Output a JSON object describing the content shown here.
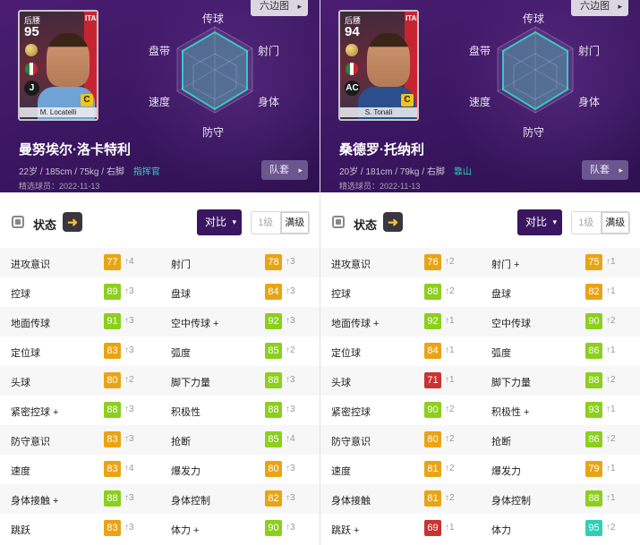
{
  "players": [
    {
      "card": {
        "position": "后腰",
        "rating": "95",
        "flag_text": "ITALIA",
        "club_badge": "J",
        "style_badge": "C",
        "card_name": "M. Locatelli",
        "shirt": "light",
        "flag_colors": [
          "#1f8a3a",
          "#ffffff",
          "#c62a30"
        ]
      },
      "hex_button": "六边图",
      "radar_labels": {
        "top": "传球",
        "upper_left": "盘带",
        "upper_right": "射门",
        "lower_left": "速度",
        "lower_right": "身体",
        "bottom": "防守"
      },
      "name": "曼努埃尔·洛卡特利",
      "info": "22岁 / 185cm / 75kg / 右脚",
      "play_style": "指挥官",
      "featured_date": "精选球员：2022-11-13",
      "team_button": "队套",
      "status": {
        "title": "状态",
        "arrow_icon": "➜",
        "compare_button": "对比",
        "level_1": "1级",
        "level_max": "满级"
      },
      "stats": [
        [
          {
            "label": "进攻意识",
            "value": "77",
            "inc": "↑4",
            "tier": "g80"
          },
          {
            "label": "射门",
            "value": "78",
            "inc": "↑3",
            "tier": "g80"
          }
        ],
        [
          {
            "label": "控球",
            "value": "89",
            "inc": "↑3",
            "tier": "g90"
          },
          {
            "label": "盘球",
            "value": "84",
            "inc": "↑3",
            "tier": "g80"
          }
        ],
        [
          {
            "label": "地面传球",
            "value": "91",
            "inc": "↑3",
            "tier": "g90"
          },
          {
            "label": "空中传球 +",
            "value": "92",
            "inc": "↑3",
            "tier": "g90"
          }
        ],
        [
          {
            "label": "定位球",
            "value": "83",
            "inc": "↑3",
            "tier": "g80"
          },
          {
            "label": "弧度",
            "value": "85",
            "inc": "↑2",
            "tier": "g90"
          }
        ],
        [
          {
            "label": "头球",
            "value": "80",
            "inc": "↑2",
            "tier": "g80"
          },
          {
            "label": "脚下力量",
            "value": "88",
            "inc": "↑3",
            "tier": "g90"
          }
        ],
        [
          {
            "label": "紧密控球 +",
            "value": "88",
            "inc": "↑3",
            "tier": "g90"
          },
          {
            "label": "积极性",
            "value": "88",
            "inc": "↑3",
            "tier": "g90"
          }
        ],
        [
          {
            "label": "防守意识",
            "value": "83",
            "inc": "↑3",
            "tier": "g80"
          },
          {
            "label": "抢断",
            "value": "85",
            "inc": "↑4",
            "tier": "g90"
          }
        ],
        [
          {
            "label": "速度",
            "value": "83",
            "inc": "↑4",
            "tier": "g80"
          },
          {
            "label": "爆发力",
            "value": "80",
            "inc": "↑3",
            "tier": "g80"
          }
        ],
        [
          {
            "label": "身体接触 +",
            "value": "88",
            "inc": "↑3",
            "tier": "g90"
          },
          {
            "label": "身体控制",
            "value": "82",
            "inc": "↑3",
            "tier": "g80"
          }
        ],
        [
          {
            "label": "跳跃",
            "value": "83",
            "inc": "↑3",
            "tier": "g80"
          },
          {
            "label": "体力 +",
            "value": "90",
            "inc": "↑3",
            "tier": "g90"
          }
        ]
      ]
    },
    {
      "card": {
        "position": "后腰",
        "rating": "94",
        "flag_text": "ITALIA",
        "club_badge": "AC",
        "style_badge": "C",
        "card_name": "S. Tonali",
        "shirt": "dark",
        "flag_colors": [
          "#1f8a3a",
          "#ffffff",
          "#c62a30"
        ]
      },
      "hex_button": "六边图",
      "radar_labels": {
        "top": "传球",
        "upper_left": "盘带",
        "upper_right": "射门",
        "lower_left": "速度",
        "lower_right": "身体",
        "bottom": "防守"
      },
      "name": "桑德罗·托纳利",
      "info": "20岁 / 181cm / 79kg / 右脚",
      "play_style": "靠山",
      "featured_date": "精选球员：2022-11-13",
      "team_button": "队套",
      "status": {
        "title": "状态",
        "arrow_icon": "➜",
        "compare_button": "对比",
        "level_1": "1级",
        "level_max": "满级"
      },
      "stats": [
        [
          {
            "label": "进攻意识",
            "value": "76",
            "inc": "↑2",
            "tier": "g80"
          },
          {
            "label": "射门 +",
            "value": "75",
            "inc": "↑1",
            "tier": "g80"
          }
        ],
        [
          {
            "label": "控球",
            "value": "88",
            "inc": "↑2",
            "tier": "g90"
          },
          {
            "label": "盘球",
            "value": "82",
            "inc": "↑1",
            "tier": "g80"
          }
        ],
        [
          {
            "label": "地面传球 +",
            "value": "92",
            "inc": "↑1",
            "tier": "g90"
          },
          {
            "label": "空中传球",
            "value": "90",
            "inc": "↑2",
            "tier": "g90"
          }
        ],
        [
          {
            "label": "定位球",
            "value": "84",
            "inc": "↑1",
            "tier": "g80"
          },
          {
            "label": "弧度",
            "value": "86",
            "inc": "↑1",
            "tier": "g90"
          }
        ],
        [
          {
            "label": "头球",
            "value": "71",
            "inc": "↑1",
            "tier": "g70"
          },
          {
            "label": "脚下力量",
            "value": "88",
            "inc": "↑2",
            "tier": "g90"
          }
        ],
        [
          {
            "label": "紧密控球",
            "value": "90",
            "inc": "↑2",
            "tier": "g90"
          },
          {
            "label": "积极性 +",
            "value": "93",
            "inc": "↑1",
            "tier": "g90"
          }
        ],
        [
          {
            "label": "防守意识",
            "value": "80",
            "inc": "↑2",
            "tier": "g80"
          },
          {
            "label": "抢断",
            "value": "86",
            "inc": "↑2",
            "tier": "g90"
          }
        ],
        [
          {
            "label": "速度",
            "value": "81",
            "inc": "↑2",
            "tier": "g80"
          },
          {
            "label": "爆发力",
            "value": "79",
            "inc": "↑1",
            "tier": "g80"
          }
        ],
        [
          {
            "label": "身体接触",
            "value": "81",
            "inc": "↑2",
            "tier": "g80"
          },
          {
            "label": "身体控制",
            "value": "88",
            "inc": "↑1",
            "tier": "g90"
          }
        ],
        [
          {
            "label": "跳跃 +",
            "value": "69",
            "inc": "↑1",
            "tier": "g70"
          },
          {
            "label": "体力",
            "value": "95",
            "inc": "↑2",
            "tier": "g95"
          }
        ]
      ]
    }
  ],
  "colors": {
    "header_purple": "#3a1660",
    "tier_95": "#2fcfb7",
    "tier_90": "#8ccf1d",
    "tier_80": "#e9a414",
    "tier_70": "#c73432",
    "play_style_accent": "#2fd0c0"
  }
}
